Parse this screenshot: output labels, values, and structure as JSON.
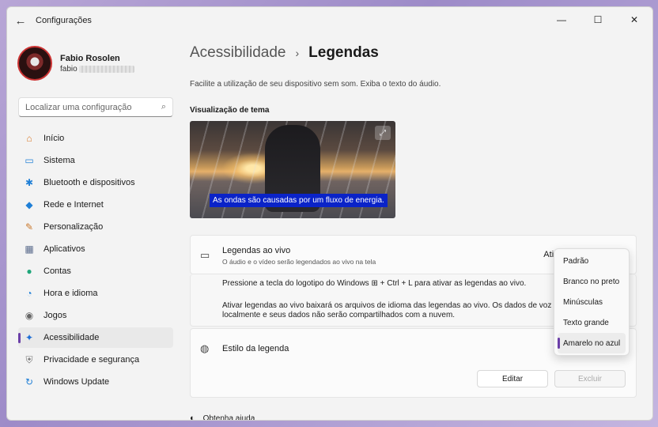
{
  "window": {
    "title": "Configurações",
    "back": "←",
    "minimize": "—",
    "maximize": "☐",
    "close": "✕"
  },
  "profile": {
    "name": "Fabio Rosolen",
    "email": "fabio"
  },
  "search": {
    "placeholder": "Localizar uma configuração",
    "icon": "⌕"
  },
  "sidebar": {
    "items": [
      {
        "label": "Início",
        "icon": "⌂",
        "color": "#d97a2b"
      },
      {
        "label": "Sistema",
        "icon": "▭",
        "color": "#1f7fd6"
      },
      {
        "label": "Bluetooth e dispositivos",
        "icon": "✱",
        "color": "#1f7fd6"
      },
      {
        "label": "Rede e Internet",
        "icon": "◆",
        "color": "#1f7fd6"
      },
      {
        "label": "Personalização",
        "icon": "✎",
        "color": "#c9772b"
      },
      {
        "label": "Aplicativos",
        "icon": "▦",
        "color": "#5a6b8c"
      },
      {
        "label": "Contas",
        "icon": "●",
        "color": "#1fa67a"
      },
      {
        "label": "Hora e idioma",
        "icon": "◔",
        "color": "#1f7fd6"
      },
      {
        "label": "Jogos",
        "icon": "◉",
        "color": "#666"
      },
      {
        "label": "Acessibilidade",
        "icon": "✦",
        "color": "#1f6fd6"
      },
      {
        "label": "Privacidade e segurança",
        "icon": "⛨",
        "color": "#777"
      },
      {
        "label": "Windows Update",
        "icon": "↻",
        "color": "#1f7fd6"
      }
    ]
  },
  "breadcrumb": {
    "parent": "Acessibilidade",
    "separator": "›",
    "current": "Legendas"
  },
  "description": "Facilite a utilização de seu dispositivo sem som. Exiba o texto do áudio.",
  "preview": {
    "heading": "Visualização de tema",
    "caption": "As ondas são causadas por um fluxo de energia.",
    "expand_icon": "⤢"
  },
  "live": {
    "title": "Legendas ao vivo",
    "subtitle": "O áudio e o vídeo serão legendados ao vivo na tela",
    "status": "Ativado",
    "icon": "▭",
    "chevron": "⌃",
    "info1": "Pressione a tecla do logotipo do Windows ⊞ + Ctrl + L para ativar as legendas ao vivo.",
    "info2": "Ativar legendas ao vivo baixará os arquivos de idioma das legendas ao vivo. Os dados de voz serão",
    "info3": "localmente e seus dados não serão compartilhados com a nuvem."
  },
  "style": {
    "title": "Estilo da legenda",
    "icon": "◍",
    "edit": "Editar",
    "delete": "Excluir"
  },
  "help": {
    "label": "Obtenha ajuda",
    "icon": "◐"
  },
  "dropdown": {
    "options": [
      "Padrão",
      "Branco no preto",
      "Minúsculas",
      "Texto grande",
      "Amarelo no azul"
    ],
    "selected": "Amarelo no azul"
  }
}
